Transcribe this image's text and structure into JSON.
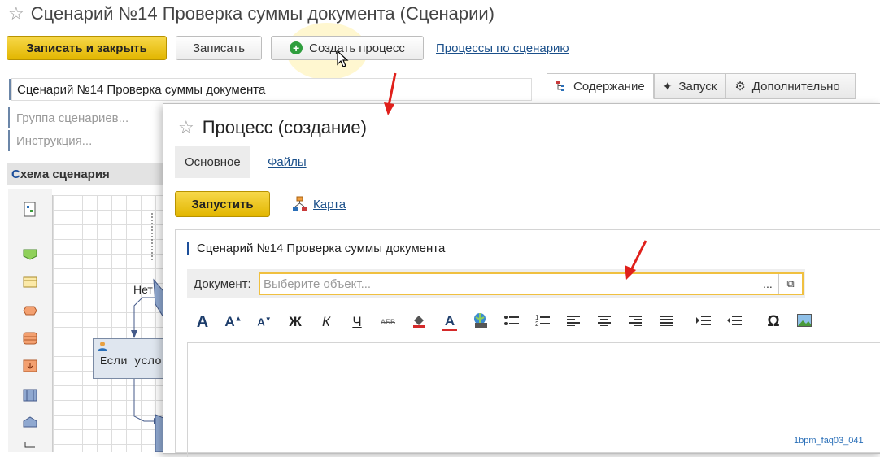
{
  "main": {
    "title": "Сценарий №14 Проверка суммы документа (Сценарии)",
    "buttons": {
      "save_close": "Записать и закрыть",
      "save": "Записать",
      "create_process": "Создать процесс"
    },
    "processes_link": "Процессы по сценарию",
    "name_field": "Сценарий №14 Проверка суммы документа",
    "group_placeholder": "Группа сценариев...",
    "instruction_placeholder": "Инструкция...",
    "schema_title_first": "С",
    "schema_title_rest": "хема сценария",
    "schema": {
      "branch_label": "Нет",
      "node_label": "Если усло"
    },
    "tabs": [
      "Содержание",
      "Запуск",
      "Дополнительно"
    ]
  },
  "dialog": {
    "title": "Процесс (создание)",
    "tabs": {
      "main": "Основное",
      "files": "Файлы"
    },
    "run_button": "Запустить",
    "map_link": "Карта",
    "scenario_label": "Сценарий №14 Проверка суммы документа",
    "document_label": "Документ:",
    "document_placeholder": "Выберите объект...",
    "document_select_dots": "...",
    "toolbar": {
      "bold_a": "A",
      "grow_a": "A",
      "shrink_a": "A",
      "bold": "Ж",
      "italic": "К",
      "underline": "Ч",
      "strike": "АБВ",
      "text_color_a": "A",
      "special_char": "Ω"
    }
  },
  "watermark": "1bpm_faq03_041",
  "colors": {
    "accent_yellow": "#e2b600",
    "link_blue": "#1a4f8a",
    "arrow_red": "#e0201b"
  }
}
